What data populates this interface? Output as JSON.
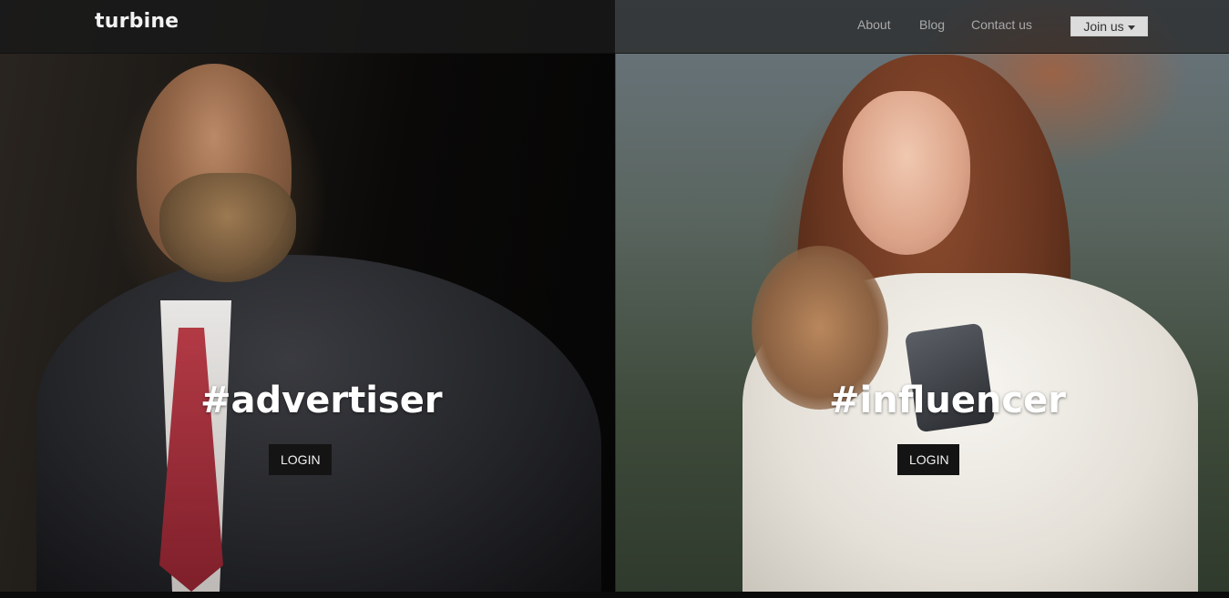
{
  "brand": {
    "name": "turbine"
  },
  "nav": {
    "about": "About",
    "blog": "Blog",
    "contact": "Contact us",
    "join": "Join us"
  },
  "panels": {
    "advertiser": {
      "tag": "#advertiser",
      "login": "LOGIN"
    },
    "influencer": {
      "tag": "#influencer",
      "login": "LOGIN"
    }
  },
  "colors": {
    "navbar_bg": "#222222",
    "join_bg": "#dcdcdc",
    "login_bg": "#141414",
    "text_white": "#ffffff"
  },
  "icons": {
    "join_dropdown": "caret-down-icon"
  }
}
